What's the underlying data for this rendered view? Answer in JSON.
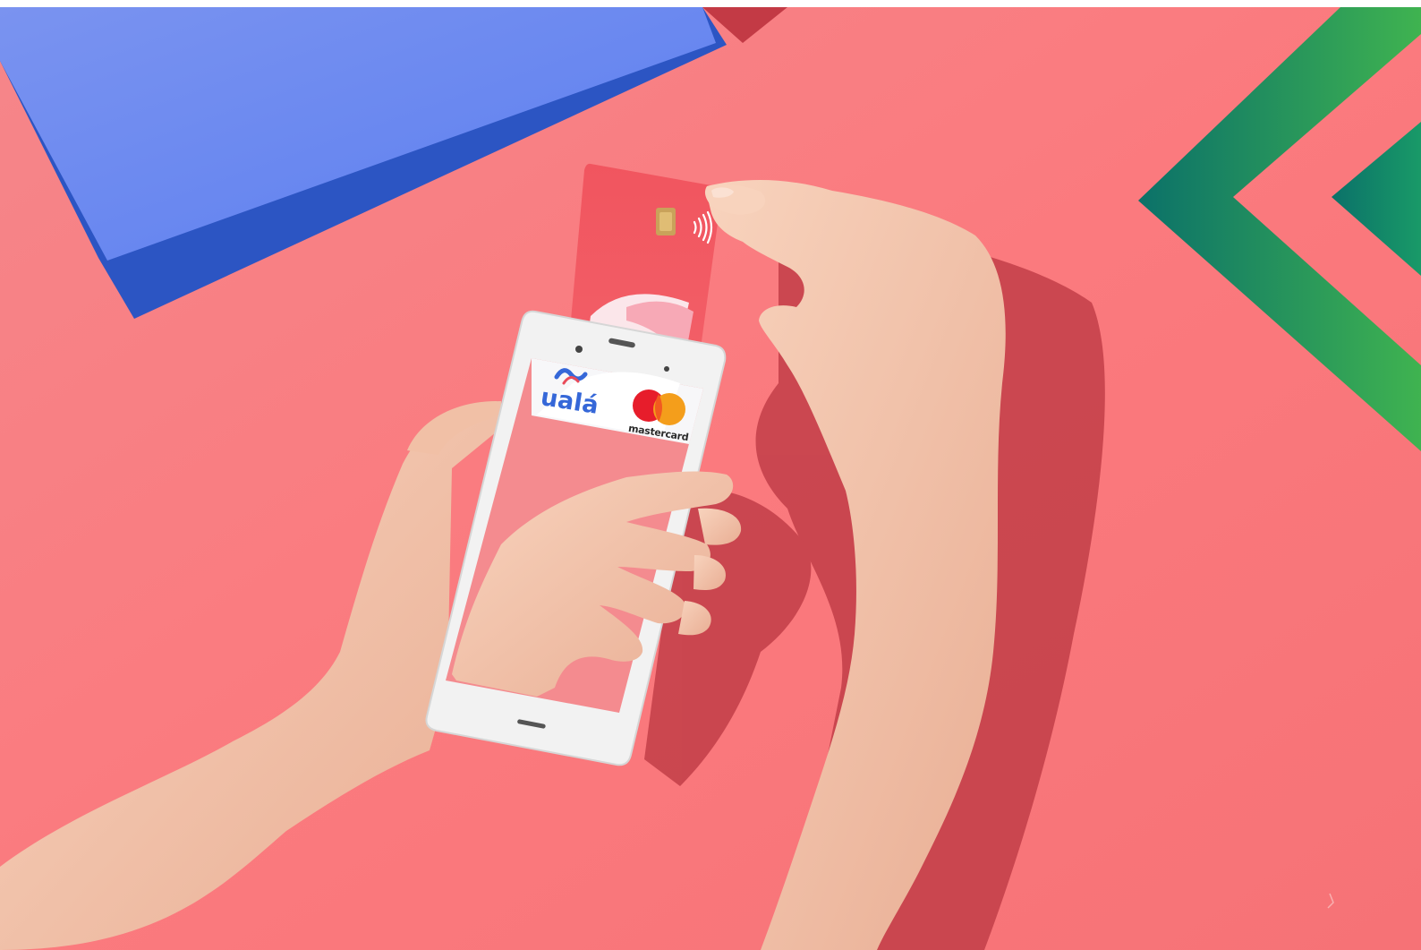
{
  "photo": {
    "card_brand_logo": "uala-logo",
    "card_network_logo": "mastercard-logo",
    "card_brand_text": "ualá",
    "card_network_text": "mastercard",
    "contactless_icon": "contactless-icon"
  },
  "colors": {
    "background": "#f97d7f",
    "blue_paper": "#2f59c5",
    "blue_paper_light": "#6e8cef",
    "card_red": "#f15a63",
    "chevron_dark": "#0f7a6c",
    "chevron_light": "#3cae55",
    "phone_frame": "#f2f2f2",
    "skin": "#f3c4ac",
    "shadow": "#b8343d"
  }
}
